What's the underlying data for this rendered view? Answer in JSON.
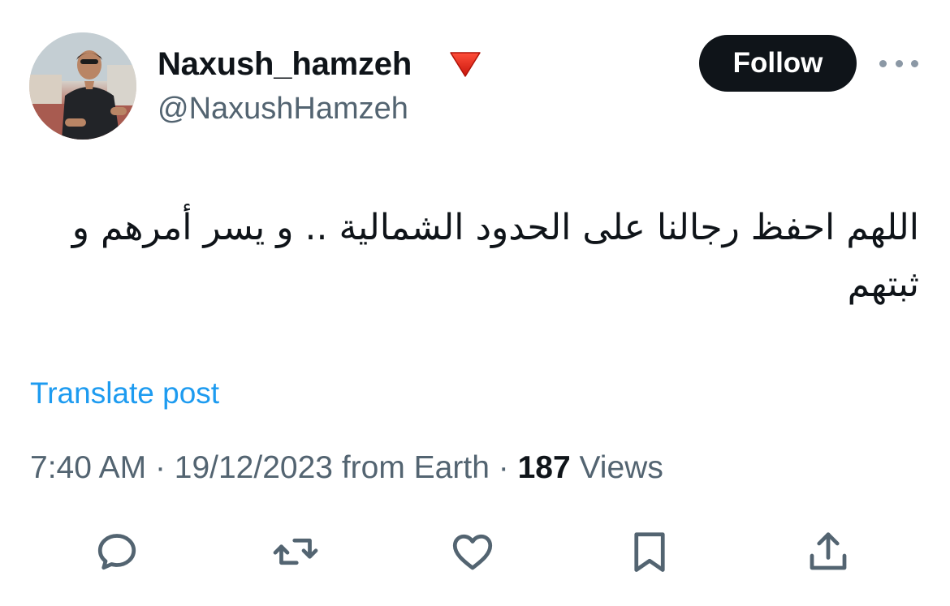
{
  "author": {
    "display_name": "Naxush_hamzeh",
    "handle": "@NaxushHamzeh",
    "badge_emoji": "red-triangle-down-icon"
  },
  "follow_label": "Follow",
  "post": {
    "text": "اللهم احفظ رجالنا على الحدود الشمالية .. و يسر أمرهم و ثبتهم",
    "translate_label": "Translate post"
  },
  "meta": {
    "time": "7:40 AM",
    "separator": "·",
    "date": "19/12/2023",
    "location": "from Earth",
    "views_count": "187",
    "views_label": "Views"
  },
  "actions": [
    {
      "name": "reply",
      "icon": "reply-icon"
    },
    {
      "name": "repost",
      "icon": "repost-icon"
    },
    {
      "name": "like",
      "icon": "heart-icon"
    },
    {
      "name": "bookmark",
      "icon": "bookmark-icon"
    },
    {
      "name": "share",
      "icon": "share-icon"
    }
  ],
  "colors": {
    "text": "#0f1419",
    "secondary": "#536471",
    "link": "#1d9bf0",
    "icon": "#536471",
    "button_bg": "#0f1419"
  }
}
